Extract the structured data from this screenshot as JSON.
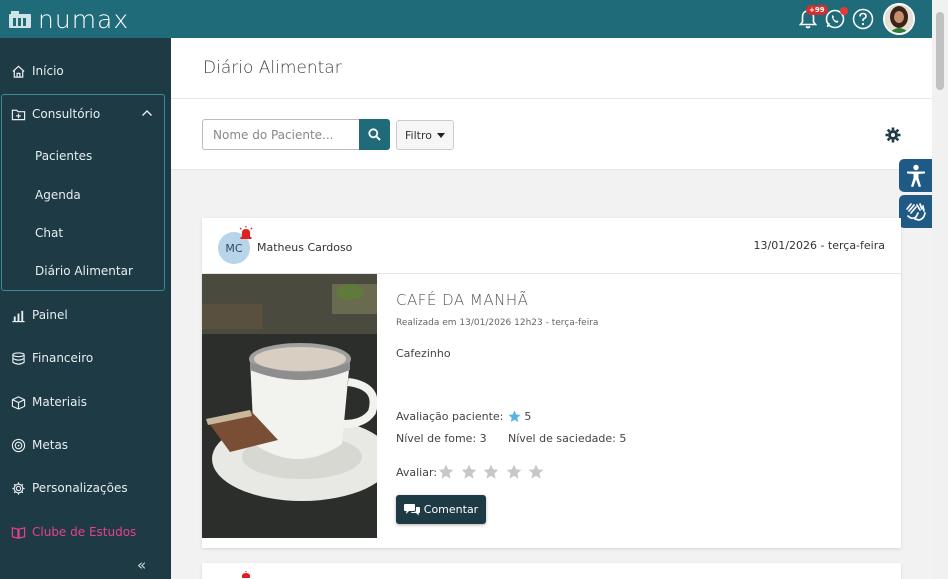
{
  "app": {
    "name": "numax"
  },
  "topbar": {
    "notification_badge": "+99"
  },
  "sidebar": {
    "items": [
      {
        "label": "Início"
      },
      {
        "label": "Consultório"
      },
      {
        "label": "Painel"
      },
      {
        "label": "Financeiro"
      },
      {
        "label": "Materiais"
      },
      {
        "label": "Metas"
      },
      {
        "label": "Personalizações"
      },
      {
        "label": "Clube de Estudos"
      }
    ],
    "sub_items": [
      {
        "label": "Pacientes"
      },
      {
        "label": "Agenda"
      },
      {
        "label": "Chat"
      },
      {
        "label": "Diário Alimentar"
      }
    ],
    "collapse_glyph": "«"
  },
  "header": {
    "title": "Diário Alimentar"
  },
  "toolbar": {
    "search_placeholder": "Nome do Paciente...",
    "filter_label": "Filtro"
  },
  "entry": {
    "patient_initials": "MC",
    "patient_name": "Matheus Cardoso",
    "date": "13/01/2026 - terça-feira",
    "meal_title": "CAFÉ DA MANHÃ",
    "meal_subtitle": "Realizada em 13/01/2026 12h23 - terça-feira",
    "description": "Cafezinho",
    "patient_rating_label": "Avaliação paciente:",
    "patient_rating_value": "5",
    "hunger_label": "Nível de fome: 3",
    "satiety_label": "Nível de saciedade: 5",
    "rate_label": "Avaliar:",
    "rate_stars_filled": 0,
    "rate_stars_total": 5,
    "comment_label": "Comentar"
  },
  "colors": {
    "brand": "#1f6b7a",
    "sidebar": "#1e3a44",
    "accent_pink": "#e8418a",
    "accessibility": "#1f5a87"
  }
}
